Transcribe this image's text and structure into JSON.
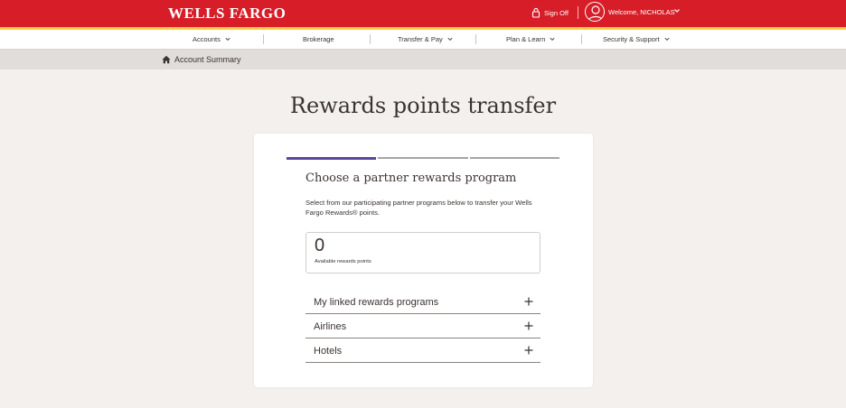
{
  "header": {
    "logo": "WELLS FARGO",
    "signoff_label": "Sign Off",
    "welcome_label": "Welcome, NICHOLAS",
    "brand_red": "#d71e28",
    "accent_gold": "#ffcd41"
  },
  "nav": {
    "items": [
      {
        "label": "Accounts",
        "has_dropdown": true
      },
      {
        "label": "Brokerage",
        "has_dropdown": false
      },
      {
        "label": "Transfer & Pay",
        "has_dropdown": true
      },
      {
        "label": "Plan & Learn",
        "has_dropdown": true
      },
      {
        "label": "Security & Support",
        "has_dropdown": true
      }
    ]
  },
  "breadcrumb": {
    "label": "Account Summary"
  },
  "page": {
    "title": "Rewards points transfer"
  },
  "card": {
    "progress_steps": 3,
    "active_step": 1,
    "progress_active_color": "#5a469b",
    "heading": "Choose a partner rewards program",
    "description": "Select from our participating partner programs below to transfer your Wells Fargo Rewards® points.",
    "points_value": "0",
    "points_label": "Available rewards points",
    "accordions": [
      {
        "label": "My linked rewards programs"
      },
      {
        "label": "Airlines"
      },
      {
        "label": "Hotels"
      }
    ]
  },
  "icons": {
    "lock": "lock-icon",
    "avatar": "user-avatar-icon",
    "home": "home-icon",
    "expand": "plus-icon",
    "dropdown": "chevron-down-icon"
  }
}
